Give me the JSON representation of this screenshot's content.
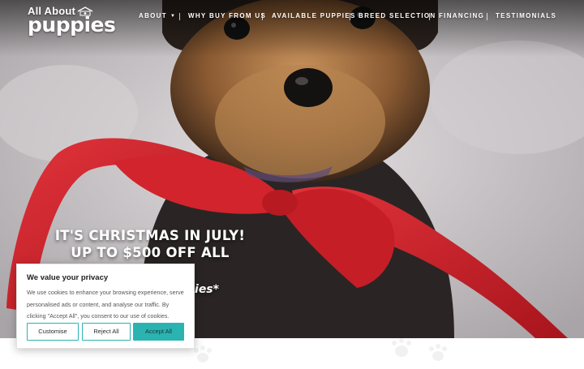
{
  "brand": {
    "top": "All About",
    "main": "puppies",
    "logo_icon": "house-with-dog-icon"
  },
  "nav": {
    "items": [
      {
        "label": "ABOUT",
        "has_dropdown": true
      },
      {
        "label": "WHY BUY FROM US"
      },
      {
        "label": "AVAILABLE PUPPIES"
      },
      {
        "label": "BREED SELECTION"
      },
      {
        "label": "FINANCING"
      },
      {
        "label": "TESTIMONIALS"
      }
    ],
    "dropdown_icon": "caret-down-icon"
  },
  "hero": {
    "line1": "IT'S CHRISTMAS IN JULY!",
    "line2": "UP TO $500 OFF ALL PUPPIES!",
    "line3_partial": "ies*",
    "image": "yorkie-puppy-with-red-ribbon"
  },
  "cookie": {
    "title": "We value your privacy",
    "text": "We use cookies to enhance your browsing experience, serve personalised ads or content, and analyse our traffic. By clicking \"Accept All\", you consent to our use of cookies.",
    "buttons": {
      "customise": "Customise",
      "reject": "Reject All",
      "accept": "Accept All"
    }
  },
  "colors": {
    "accent": "#2ab3b1",
    "ribbon": "#d9232d",
    "nav_text": "#ffffff"
  }
}
